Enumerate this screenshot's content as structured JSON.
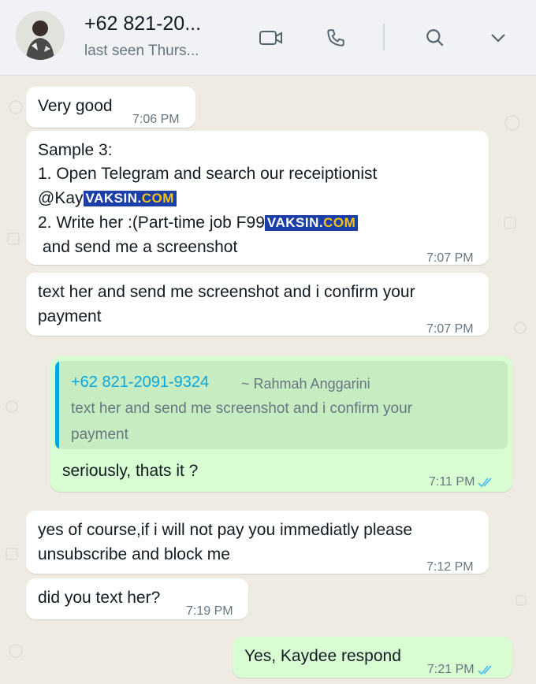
{
  "header": {
    "contact_name": "+62 821-20...",
    "status": "last seen Thurs...",
    "icons": [
      "video-call-icon",
      "voice-call-icon",
      "search-icon",
      "chevron-down-icon"
    ]
  },
  "messages": [
    {
      "direction": "in",
      "lines": [
        "Very good"
      ],
      "time": "7:06 PM"
    },
    {
      "direction": "in",
      "lines": [
        "Sample 3:",
        "1. Open Telegram and search our receiptionist",
        "@Kay",
        "2. Write her :(Part-time job F99",
        " and send me a screenshot"
      ],
      "time": "7:07 PM"
    },
    {
      "direction": "in",
      "lines": [
        "text her and send me screenshot and i confirm your",
        "payment"
      ],
      "time": "7:07 PM"
    },
    {
      "direction": "out",
      "quote": {
        "number": "+62 821-2091-9324",
        "name": "~ Rahmah Anggarini",
        "lines": [
          "text her and send me screenshot and i confirm your",
          "payment"
        ]
      },
      "lines": [
        "seriously, thats it ?"
      ],
      "time": "7:11 PM"
    },
    {
      "direction": "in",
      "lines": [
        "yes of course,if i will not pay you immediatly please",
        "unsubscribe and block me"
      ],
      "time": "7:12 PM"
    },
    {
      "direction": "in",
      "lines": [
        "did you text her?"
      ],
      "time": "7:19 PM"
    },
    {
      "direction": "out",
      "lines": [
        "Yes, Kaydee respond"
      ],
      "time": "7:21 PM"
    }
  ],
  "watermark": {
    "left": "VAKSIN.",
    "right": "COM"
  },
  "colors": {
    "incoming": "#ffffff",
    "outgoing": "#d9fdd3",
    "background": "#efeae2",
    "read_ticks": "#53bdeb",
    "quote_accent": "#06a6e0"
  }
}
